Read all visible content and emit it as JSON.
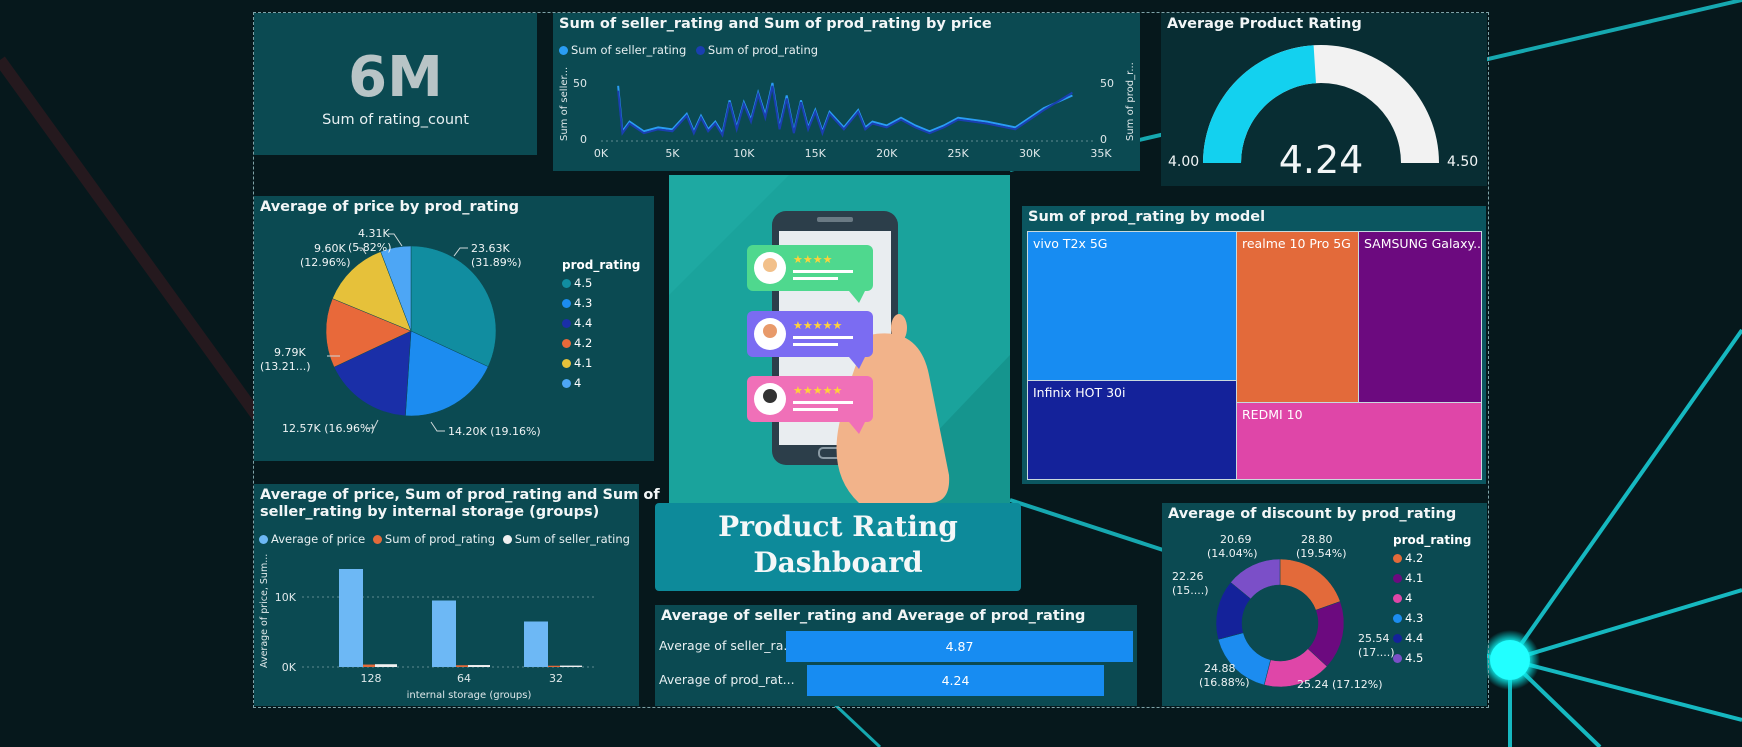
{
  "dashboard_title": "Product Rating Dashboard",
  "card": {
    "value": "6M",
    "label": "Sum of rating_count"
  },
  "line_chart": {
    "title": "Sum of seller_rating and Sum of prod_rating by price",
    "legend": [
      {
        "name": "Sum of seller_rating",
        "color": "#2a9df4"
      },
      {
        "name": "Sum of prod_rating",
        "color": "#1a3fb0"
      }
    ],
    "y_left_label": "Sum of seller...",
    "y_right_label": "Sum of prod_r...",
    "y_ticks": [
      "50",
      "0"
    ],
    "x_ticks": [
      "0K",
      "5K",
      "10K",
      "15K",
      "20K",
      "25K",
      "30K",
      "35K"
    ]
  },
  "gauge": {
    "title": "Average Product Rating",
    "value": "4.24",
    "min": "4.00",
    "max": "4.50",
    "fill_fraction": 0.48
  },
  "pie": {
    "title": "Average of price by prod_rating",
    "legend_title": "prod_rating",
    "legend": [
      {
        "label": "4.5",
        "color": "#118da0"
      },
      {
        "label": "4.3",
        "color": "#1c8cf0"
      },
      {
        "label": "4.4",
        "color": "#1a2fa8"
      },
      {
        "label": "4.2",
        "color": "#e8693a"
      },
      {
        "label": "4.1",
        "color": "#e6c13a"
      },
      {
        "label": "4",
        "color": "#4da6f5"
      }
    ],
    "labels": [
      {
        "l1": "23.63K",
        "l2": "(31.89%)"
      },
      {
        "l1": "14.20K (19.16%)",
        "l2": ""
      },
      {
        "l1": "12.57K (16.96%)",
        "l2": ""
      },
      {
        "l1": "9.79K",
        "l2": "(13.21...)"
      },
      {
        "l1": "9.60K",
        "l2": "(12.96%)"
      },
      {
        "l1": "4.31K",
        "l2": "(5.82%)"
      }
    ]
  },
  "treemap": {
    "title": "Sum of prod_rating by model",
    "cells": [
      {
        "label": "vivo T2x 5G",
        "color": "#178cf2"
      },
      {
        "label": "realme 10 Pro 5G",
        "color": "#e36a3a"
      },
      {
        "label": "SAMSUNG Galaxy...",
        "color": "#6c0a7f"
      },
      {
        "label": "Infinix HOT 30i",
        "color": "#14229a"
      },
      {
        "label": "REDMI 10",
        "color": "#df46a8"
      }
    ]
  },
  "bar_chart": {
    "title_line1": "Average of price, Sum of prod_rating and Sum of",
    "title_line2": "seller_rating by internal storage (groups)",
    "legend": [
      {
        "name": "Average of price",
        "color": "#6db8f5"
      },
      {
        "name": "Sum of prod_rating",
        "color": "#e36a3a"
      },
      {
        "name": "Sum of seller_rating",
        "color": "#f0f0f0"
      }
    ],
    "y_label": "Average of price, Sum...",
    "x_label": "internal storage (groups)",
    "y_ticks": [
      "10K",
      "0K"
    ]
  },
  "hbar": {
    "title": "Average of seller_rating and Average of prod_rating",
    "rows": [
      {
        "label": "Average of seller_ra...",
        "value": "4.87"
      },
      {
        "label": "Average of prod_rat...",
        "value": "4.24"
      }
    ]
  },
  "donut": {
    "title": "Average of discount by prod_rating",
    "legend_title": "prod_rating",
    "legend": [
      {
        "label": "4.2",
        "color": "#e36a3a"
      },
      {
        "label": "4.1",
        "color": "#6c0a7f"
      },
      {
        "label": "4",
        "color": "#df46a8"
      },
      {
        "label": "4.3",
        "color": "#1c8cf0"
      },
      {
        "label": "4.4",
        "color": "#14229a"
      },
      {
        "label": "4.5",
        "color": "#7b4fc8"
      }
    ],
    "labels": [
      {
        "l1": "28.80",
        "l2": "(19.54%)"
      },
      {
        "l1": "25.54",
        "l2": "(17....)"
      },
      {
        "l1": "25.24 (17.12%)",
        "l2": ""
      },
      {
        "l1": "24.88",
        "l2": "(16.88%)"
      },
      {
        "l1": "22.26",
        "l2": "(15....)"
      },
      {
        "l1": "20.69",
        "l2": "(14.04%)"
      }
    ]
  },
  "chart_data": [
    {
      "type": "line",
      "title": "Sum of seller_rating and Sum of prod_rating by price",
      "xlabel": "",
      "ylabel": "",
      "xlim": [
        0,
        35000
      ],
      "ylim": [
        0,
        60
      ],
      "series": [
        {
          "name": "Sum of seller_rating",
          "x": [
            1200,
            1500,
            2000,
            3000,
            4000,
            5000,
            6000,
            6500,
            7000,
            7500,
            8000,
            8500,
            9000,
            9500,
            10000,
            10500,
            11000,
            11500,
            12000,
            12500,
            13000,
            13500,
            14000,
            14500,
            15000,
            15500,
            16000,
            17000,
            18000,
            18500,
            19000,
            20000,
            21000,
            22000,
            23000,
            24000,
            25000,
            27000,
            29000,
            31000,
            33000
          ],
          "y": [
            55,
            8,
            18,
            8,
            12,
            10,
            26,
            8,
            24,
            10,
            18,
            6,
            40,
            12,
            38,
            20,
            48,
            25,
            58,
            12,
            45,
            8,
            40,
            12,
            30,
            8,
            28,
            12,
            30,
            12,
            18,
            14,
            22,
            14,
            8,
            14,
            22,
            18,
            12,
            32,
            45
          ]
        },
        {
          "name": "Sum of prod_rating",
          "x": [
            1200,
            1500,
            2000,
            3000,
            4000,
            5000,
            6000,
            6500,
            7000,
            7500,
            8000,
            8500,
            9000,
            9500,
            10000,
            10500,
            11000,
            11500,
            12000,
            12500,
            13000,
            13500,
            14000,
            14500,
            15000,
            15500,
            16000,
            17000,
            18000,
            18500,
            19000,
            20000,
            21000,
            22000,
            23000,
            24000,
            25000,
            27000,
            29000,
            31000,
            33000
          ],
          "y": [
            50,
            6,
            16,
            6,
            10,
            8,
            24,
            6,
            22,
            8,
            16,
            4,
            38,
            10,
            36,
            18,
            46,
            22,
            55,
            10,
            42,
            6,
            38,
            10,
            28,
            6,
            26,
            10,
            28,
            10,
            16,
            12,
            20,
            12,
            6,
            12,
            20,
            16,
            10,
            30,
            48
          ]
        }
      ]
    },
    {
      "type": "pie",
      "title": "Average of price by prod_rating",
      "categories": [
        "4.5",
        "4.3",
        "4.4",
        "4.2",
        "4.1",
        "4"
      ],
      "values": [
        23630,
        14200,
        12570,
        9790,
        9600,
        4310
      ]
    },
    {
      "type": "bar",
      "title": "Average of price, Sum of prod_rating and Sum of seller_rating by internal storage (groups)",
      "categories": [
        "128",
        "64",
        "32"
      ],
      "xlabel": "internal storage (groups)",
      "ylim": [
        0,
        15000
      ],
      "series": [
        {
          "name": "Average of price",
          "values": [
            14000,
            9500,
            6500
          ]
        },
        {
          "name": "Sum of prod_rating",
          "values": [
            350,
            250,
            180
          ]
        },
        {
          "name": "Sum of seller_rating",
          "values": [
            400,
            280,
            200
          ]
        }
      ]
    },
    {
      "type": "bar",
      "title": "Average of seller_rating and Average of prod_rating",
      "categories": [
        "Average of seller_ra...",
        "Average of prod_rat..."
      ],
      "values": [
        4.87,
        4.24
      ]
    },
    {
      "type": "pie",
      "title": "Average of discount by prod_rating",
      "categories": [
        "4.2",
        "4.1",
        "4",
        "4.3",
        "4.4",
        "4.5"
      ],
      "values": [
        28.8,
        25.54,
        25.24,
        24.88,
        22.26,
        20.69
      ]
    }
  ]
}
